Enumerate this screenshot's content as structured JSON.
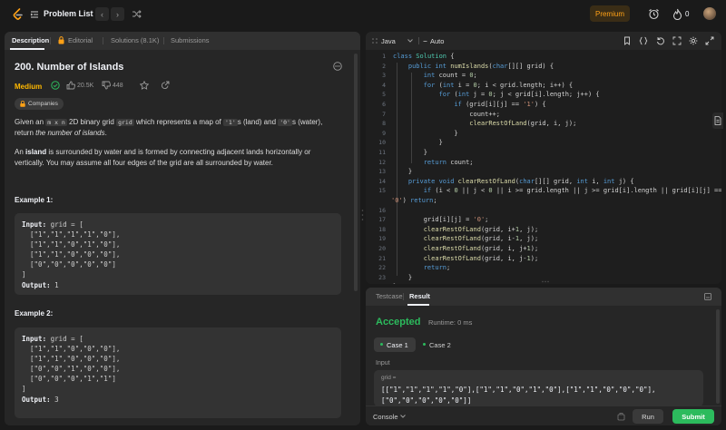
{
  "topbar": {
    "problem_list": "Problem List",
    "premium": "Premium",
    "streak": "0"
  },
  "left": {
    "tabs": [
      "Description",
      "Editorial",
      "Solutions (8.1K)",
      "Submissions"
    ],
    "title": "200. Number of Islands",
    "difficulty": "Medium",
    "likes": "20.5K",
    "dislikes": "448",
    "companies": "Companies",
    "desc1_a": "Given an ",
    "desc1_code1": "m x n",
    "desc1_b": " 2D binary grid ",
    "desc1_code2": "grid",
    "desc1_c": " which represents a map of ",
    "desc1_code3": "'1'",
    "desc1_d": "s (land) and ",
    "desc1_code4": "'0'",
    "desc1_e": "s (water), return ",
    "desc1_f": "the number of islands",
    "desc1_g": ".",
    "desc2_a": "An ",
    "desc2_b": "island",
    "desc2_c": " is surrounded by water and is formed by connecting adjacent lands horizontally or vertically. You may assume all four edges of the grid are all surrounded by water.",
    "example1_title": "Example 1:",
    "example1_lines": [
      "grid = [",
      "  [\"1\",\"1\",\"1\",\"1\",\"0\"],",
      "  [\"1\",\"1\",\"0\",\"1\",\"0\"],",
      "  [\"1\",\"1\",\"0\",\"0\",\"0\"],",
      "  [\"0\",\"0\",\"0\",\"0\",\"0\"]",
      "]"
    ],
    "example1_output": "1",
    "example2_title": "Example 2:",
    "example2_lines": [
      "grid = [",
      "  [\"1\",\"1\",\"0\",\"0\",\"0\"],",
      "  [\"1\",\"1\",\"0\",\"0\",\"0\"],",
      "  [\"0\",\"0\",\"1\",\"0\",\"0\"],",
      "  [\"0\",\"0\",\"0\",\"1\",\"1\"]",
      "]"
    ],
    "example2_output": "3",
    "input_label": "Input:",
    "output_label": "Output:"
  },
  "editor": {
    "language": "Java",
    "mode": "Auto",
    "line_numbers": [
      "1",
      "2",
      "3",
      "4",
      "5",
      "6",
      "7",
      "8",
      "9",
      "10",
      "11",
      "12",
      "13",
      "14",
      "15",
      "",
      "16",
      "17",
      "18",
      "19",
      "20",
      "21",
      "22",
      "23"
    ]
  },
  "result": {
    "tabs": [
      "Testcase",
      "Result"
    ],
    "status": "Accepted",
    "runtime": "Runtime: 0 ms",
    "case1": "Case 1",
    "case2": "Case 2",
    "input_label": "Input",
    "var_label": "grid =",
    "input_value": "[[\"1\",\"1\",\"1\",\"1\",\"0\"],[\"1\",\"1\",\"0\",\"1\",\"0\"],[\"1\",\"1\",\"0\",\"0\",\"0\"],",
    "input_value2": "[\"0\",\"0\",\"0\",\"0\",\"0\"]]",
    "console": "Console",
    "run": "Run",
    "submit": "Submit"
  },
  "colors": {
    "accent": "#ffa116",
    "accepted": "#2cbb5d",
    "medium": "#ffb800"
  }
}
